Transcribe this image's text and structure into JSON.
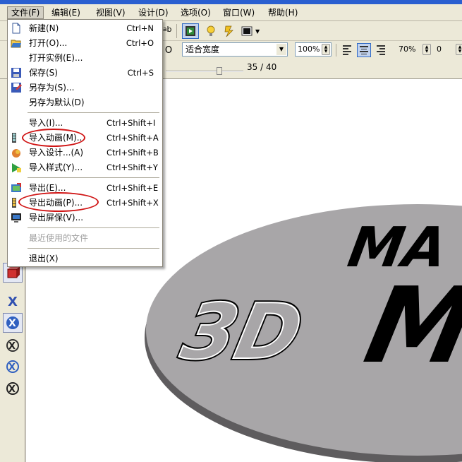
{
  "menubar": {
    "file": "文件(F)",
    "edit": "编辑(E)",
    "view": "视图(V)",
    "design": "设计(D)",
    "options": "选项(O)",
    "window": "窗口(W)",
    "help": "帮助(H)"
  },
  "toolbar": {
    "fit_width": "适合宽度",
    "zoom": "100%",
    "scale": "70%",
    "offset": "0",
    "frame": "35 / 40",
    "ab_text": "ab"
  },
  "file_menu": {
    "items": [
      {
        "label": "新建(N)",
        "shortcut": "Ctrl+N",
        "icon": "new-document-icon"
      },
      {
        "label": "打开(O)...",
        "shortcut": "Ctrl+O",
        "icon": "open-folder-icon"
      },
      {
        "label": "打开实例(E)...",
        "shortcut": "",
        "icon": ""
      },
      {
        "label": "保存(S)",
        "shortcut": "Ctrl+S",
        "icon": "save-disk-icon"
      },
      {
        "label": "另存为(S)...",
        "shortcut": "",
        "icon": "save-as-icon"
      },
      {
        "label": "另存为默认(D)",
        "shortcut": "",
        "icon": ""
      },
      {
        "label": "导入(I)...",
        "shortcut": "Ctrl+Shift+I",
        "icon": ""
      },
      {
        "label": "导入动画(M)...",
        "shortcut": "Ctrl+Shift+A",
        "icon": "import-animation-icon"
      },
      {
        "label": "导入设计...(A)",
        "shortcut": "Ctrl+Shift+B",
        "icon": "import-design-icon"
      },
      {
        "label": "导入样式(Y)...",
        "shortcut": "Ctrl+Shift+Y",
        "icon": "import-style-icon"
      },
      {
        "label": "导出(E)...",
        "shortcut": "Ctrl+Shift+E",
        "icon": "export-icon"
      },
      {
        "label": "导出动画(P)...",
        "shortcut": "Ctrl+Shift+X",
        "icon": "export-animation-icon"
      },
      {
        "label": "导出屏保(V)...",
        "shortcut": "",
        "icon": "export-screensaver-icon"
      },
      {
        "label": "最近使用的文件",
        "shortcut": "",
        "icon": ""
      },
      {
        "label": "退出(X)",
        "shortcut": "",
        "icon": ""
      }
    ]
  },
  "canvas": {
    "text_top": "MA",
    "text_3d": "3D",
    "text_big": "M",
    "disc_color": "#a8a6a8",
    "disc_edge_color": "#5e5c5e"
  },
  "colors": {
    "highlight_oval": "#d01515",
    "menu_bg": "#ffffff",
    "toolbar_bg": "#ece9d8"
  }
}
